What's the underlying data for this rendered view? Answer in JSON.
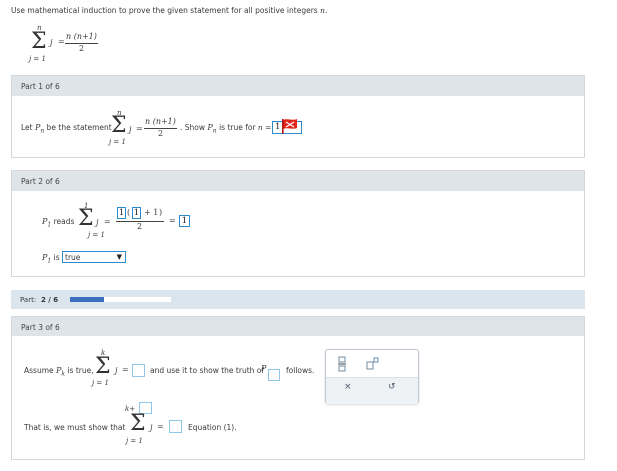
{
  "instruction": "Use mathematical induction to prove the given statement for all positive integers",
  "instruction_var": "n",
  "instruction_end": ".",
  "statement": {
    "upper": "n",
    "sigma": "Σ",
    "var": "j",
    "eq": "=",
    "lower": "j = 1",
    "numerator": "n (n+1)",
    "denominator": "2"
  },
  "part1": {
    "header": "Part 1 of 6",
    "text_let": "Let",
    "p_sub": "n",
    "text_be": "be the statement",
    "text_show": ". Show",
    "text_true_for": "is true for",
    "n_eq": "n =",
    "answer": "1",
    "upper": "n",
    "lower": "j = 1",
    "numerator": "n (n+1)",
    "denominator": "2"
  },
  "part2": {
    "header": "Part 2 of 6",
    "p_sub": "1",
    "reads": "reads",
    "upper": "1",
    "lower": "j = 1",
    "num_a": "1",
    "num_b": "1",
    "num_plus": "+ 1",
    "denominator": "2",
    "result": "1",
    "is_label": "is",
    "select_value": "true"
  },
  "progress": {
    "label": "Part:",
    "value": "2 / 6",
    "fraction": 0.333,
    "fill_color": "#3a6fbf",
    "track_color": "#ffffff"
  },
  "part3": {
    "header": "Part 3 of 6",
    "assume": "Assume",
    "p_sub": "k",
    "is_true": "is true,",
    "upper": "k",
    "lower": "j = 1",
    "use_text": "and use it to show the truth of",
    "follows": "follows.",
    "that_is": "That is, we must show that",
    "upper2": "k+",
    "equation": "Equation (1).",
    "tools": {
      "fraction_icon": "fraction-icon",
      "superscript_icon": "superscript-icon",
      "clear_label": "×",
      "undo_label": "↺"
    }
  }
}
